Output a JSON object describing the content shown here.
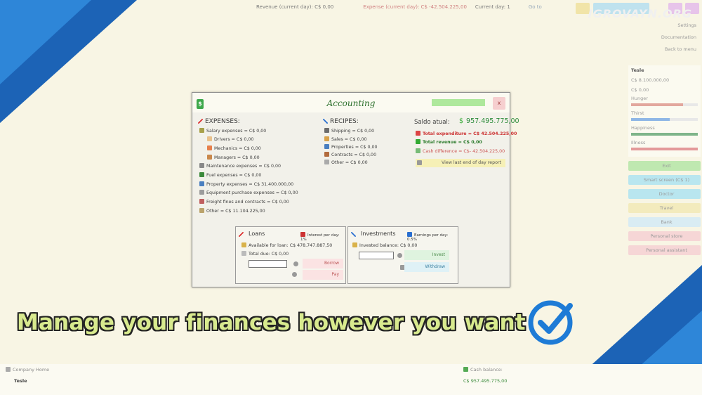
{
  "topbar": {
    "revenue": "Revenue (current day): C$  0,00",
    "expense": "Expense (current day): C$ -42.504.225,00",
    "current_day": "Current day: 1",
    "goto": "Go to"
  },
  "brand": "IGROVAYN.ORG",
  "sidebar": {
    "links": [
      "Settings",
      "Documentation",
      "Back to menu"
    ],
    "company_name": "Tesle",
    "money": "C$  8.100.000,00",
    "money2": "C$  0,00",
    "stats": [
      {
        "label": "Hunger",
        "level": 0.78,
        "color": "#e2a79d"
      },
      {
        "label": "Thirst",
        "level": 0.58,
        "color": "#8fb7e6"
      },
      {
        "label": "Happiness",
        "level": 1.0,
        "color": "#7fb58a"
      },
      {
        "label": "Illness",
        "level": 1.0,
        "color": "#e39a9a"
      }
    ],
    "buttons": [
      {
        "label": "Exit",
        "color": "#bfe8b0"
      },
      {
        "label": "Smart screen (C$ 1)",
        "color": "#b9e6ef"
      },
      {
        "label": "Doctor",
        "color": "#b9e6ef"
      },
      {
        "label": "Travel",
        "color": "#f3ebbd"
      },
      {
        "label": "Bank",
        "color": "#d9ecf3"
      },
      {
        "label": "Personal store",
        "color": "#f6d6d6"
      },
      {
        "label": "Personal assistant",
        "color": "#f6d6d6"
      }
    ]
  },
  "bottom": {
    "company_home": "Company Home",
    "company_name": "Tesle",
    "cash_label": "Cash balance:",
    "cash_value": "C$  957.495.775,00"
  },
  "window": {
    "title": "Accounting",
    "close": "x",
    "expenses": {
      "title": "EXPENSES:",
      "items": [
        "Salary expenses = C$ 0,00",
        "Drivers = C$ 0,00",
        "Mechanics = C$ 0,00",
        "Managers = C$ 0,00",
        "Maintenance expenses = C$ 0,00",
        "Fuel expenses = C$ 0,00",
        "Property expenses = C$   31.400.000,00",
        "Equipment purchase expenses = C$   0,00",
        "Freight fines and contracts = C$   0,00",
        "Other = C$ 11.104.225,00"
      ]
    },
    "recipes": {
      "title": "RECIPES:",
      "items": [
        "Shipping = C$ 0,00",
        "Sales = C$ 0,00",
        "Properties = C$   0,00",
        "Contracts = C$   0,00",
        "Other = C$ 0,00"
      ]
    },
    "saldo": {
      "label": "Saldo atual:",
      "value": "957.495.775,00",
      "total_expenditure": "Total expenditure = C$ 42.504.225,00",
      "total_revenue": "Total revenue = C$ 0,00",
      "cash_difference": "Cash difference = C$- 42.504.225,00",
      "report_button": "View last end of day report"
    },
    "loans": {
      "title": "Loans",
      "rate": "Interest per day: 1%",
      "available": "Available for loan: C$ 478.747.887,50",
      "total_due": "Total due: C$ 0,00",
      "input_value": "",
      "borrow": "Borrow",
      "pay": "Pay"
    },
    "investments": {
      "title": "Investments",
      "rate": "Earnings per day: 0.5%",
      "balance": "Invested balance: C$ 0,00",
      "input_value": "",
      "invest": "Invest",
      "withdraw": "Withdraw"
    }
  },
  "caption": "Manage your finances however you want"
}
